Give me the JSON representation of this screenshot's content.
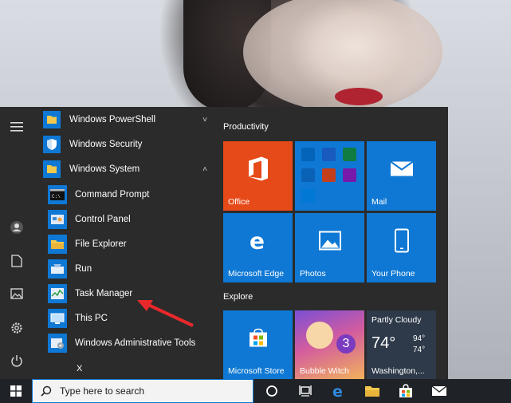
{
  "wallpaper": {
    "subject": "portrait-photo"
  },
  "rail": {
    "items": [
      {
        "icon": "hamburger-menu-icon"
      },
      {
        "icon": "user-avatar-icon"
      },
      {
        "icon": "documents-icon"
      },
      {
        "icon": "pictures-icon"
      },
      {
        "icon": "settings-gear-icon"
      },
      {
        "icon": "power-icon"
      }
    ]
  },
  "apps": {
    "items": [
      {
        "label": "Windows PowerShell",
        "icon": "folder-icon",
        "chevron": "˅"
      },
      {
        "label": "Windows Security",
        "icon": "shield-icon"
      },
      {
        "label": "Windows System",
        "icon": "folder-icon",
        "chevron": "˄"
      },
      {
        "label": "Command Prompt",
        "icon": "command-prompt-icon"
      },
      {
        "label": "Control Panel",
        "icon": "control-panel-icon"
      },
      {
        "label": "File Explorer",
        "icon": "file-explorer-icon"
      },
      {
        "label": "Run",
        "icon": "run-icon"
      },
      {
        "label": "Task Manager",
        "icon": "task-manager-icon"
      },
      {
        "label": "This PC",
        "icon": "this-pc-icon"
      },
      {
        "label": "Windows Administrative Tools",
        "icon": "admin-tools-icon"
      }
    ],
    "next_letter": "X"
  },
  "tiles": {
    "productivity_title": "Productivity",
    "explore_title": "Explore",
    "office": "Office",
    "mail": "Mail",
    "edge": "Microsoft Edge",
    "photos": "Photos",
    "phone": "Your Phone",
    "store": "Microsoft Store",
    "game": "Bubble Witch",
    "weather": {
      "condition": "Partly Cloudy",
      "temp": "74°",
      "high": "94°",
      "low": "74°",
      "location": "Washington,..."
    }
  },
  "taskbar": {
    "search_placeholder": "Type here to search",
    "icons": [
      "cortana-icon",
      "task-view-icon",
      "edge-icon",
      "file-explorer-icon",
      "store-icon",
      "mail-icon"
    ]
  },
  "colors": {
    "tile_blue": "#0f78d4",
    "office_orange": "#e64a19",
    "menu_bg": "#2b2b2b",
    "taskbar_bg": "#1f2226",
    "annotation_arrow": "#e8282b"
  }
}
